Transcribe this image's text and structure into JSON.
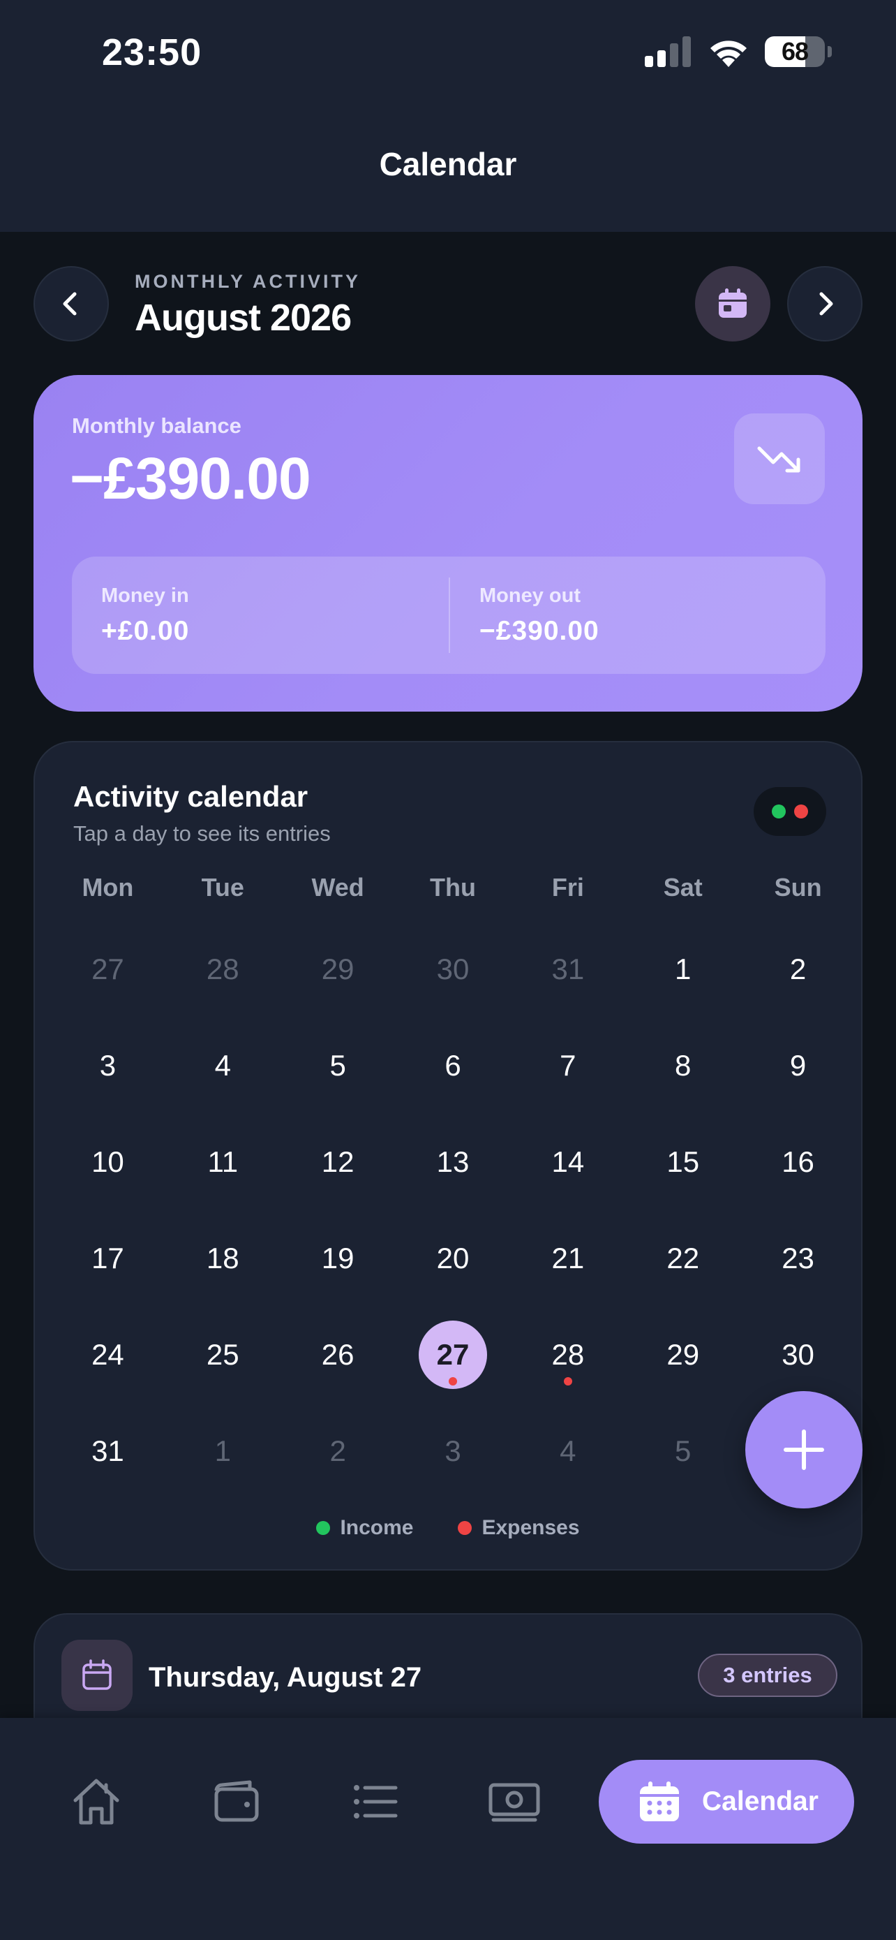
{
  "status_bar": {
    "time": "23:50",
    "battery_percent": 68,
    "battery_text": "68"
  },
  "header": {
    "title": "Calendar"
  },
  "month_nav": {
    "kicker": "MONTHLY ACTIVITY",
    "month": "August 2026"
  },
  "balance": {
    "label": "Monthly balance",
    "amount": "−£390.00",
    "money_in_label": "Money in",
    "money_in_value": "+£0.00",
    "money_out_label": "Money out",
    "money_out_value": "−£390.00"
  },
  "calendar": {
    "title": "Activity calendar",
    "subtitle": "Tap a day to see its entries",
    "weekdays": [
      "Mon",
      "Tue",
      "Wed",
      "Thu",
      "Fri",
      "Sat",
      "Sun"
    ],
    "days": [
      {
        "n": "27",
        "muted": true
      },
      {
        "n": "28",
        "muted": true
      },
      {
        "n": "29",
        "muted": true
      },
      {
        "n": "30",
        "muted": true
      },
      {
        "n": "31",
        "muted": true
      },
      {
        "n": "1"
      },
      {
        "n": "2"
      },
      {
        "n": "3"
      },
      {
        "n": "4"
      },
      {
        "n": "5"
      },
      {
        "n": "6"
      },
      {
        "n": "7"
      },
      {
        "n": "8"
      },
      {
        "n": "9"
      },
      {
        "n": "10"
      },
      {
        "n": "11"
      },
      {
        "n": "12"
      },
      {
        "n": "13"
      },
      {
        "n": "14"
      },
      {
        "n": "15"
      },
      {
        "n": "16"
      },
      {
        "n": "17"
      },
      {
        "n": "18"
      },
      {
        "n": "19"
      },
      {
        "n": "20"
      },
      {
        "n": "21"
      },
      {
        "n": "22"
      },
      {
        "n": "23"
      },
      {
        "n": "24"
      },
      {
        "n": "25"
      },
      {
        "n": "26"
      },
      {
        "n": "27",
        "selected": true,
        "expense": true
      },
      {
        "n": "28",
        "expense": true
      },
      {
        "n": "29"
      },
      {
        "n": "30"
      },
      {
        "n": "31"
      },
      {
        "n": "1",
        "muted": true
      },
      {
        "n": "2",
        "muted": true
      },
      {
        "n": "3",
        "muted": true
      },
      {
        "n": "4",
        "muted": true
      },
      {
        "n": "5",
        "muted": true
      },
      {
        "n": "6",
        "muted": true
      }
    ],
    "legend_income": "Income",
    "legend_expenses": "Expenses"
  },
  "entries": {
    "title": "Thursday, August 27",
    "badge": "3 entries"
  },
  "tabbar": {
    "active_label": "Calendar"
  },
  "colors": {
    "accent": "#a38cf7",
    "income": "#22c55e",
    "expense": "#ef4444",
    "background": "#0f141b",
    "surface": "#1b2232"
  },
  "icons": [
    "chevron-left-icon",
    "calendar-icon",
    "chevron-right-icon",
    "trending-down-icon",
    "plus-icon",
    "home-icon",
    "wallet-icon",
    "list-icon",
    "banknote-icon"
  ]
}
